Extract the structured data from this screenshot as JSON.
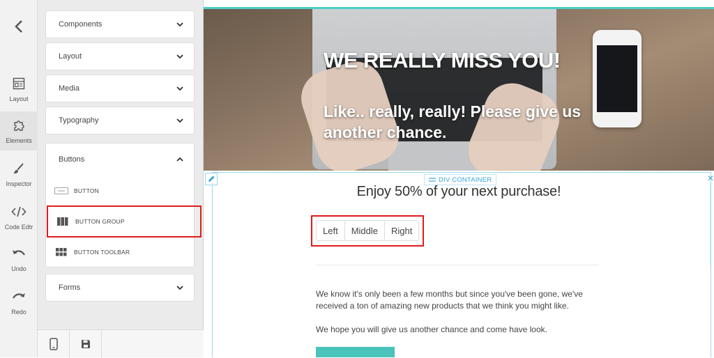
{
  "sidebar_rail": {
    "items": [
      {
        "label": "Layout",
        "icon": "layout-icon"
      },
      {
        "label": "Elements",
        "icon": "puzzle-icon"
      },
      {
        "label": "Inspector",
        "icon": "brush-icon"
      },
      {
        "label": "Code Edtr",
        "icon": "code-icon"
      },
      {
        "label": "Undo",
        "icon": "undo-icon"
      },
      {
        "label": "Redo",
        "icon": "redo-icon"
      }
    ],
    "active": "Elements"
  },
  "panel": {
    "sections": [
      {
        "label": "Components",
        "expanded": false
      },
      {
        "label": "Layout",
        "expanded": false
      },
      {
        "label": "Media",
        "expanded": false
      },
      {
        "label": "Typography",
        "expanded": false
      },
      {
        "label": "Buttons",
        "expanded": true
      },
      {
        "label": "Forms",
        "expanded": false
      }
    ],
    "buttons_items": [
      {
        "label": "BUTTON",
        "icon": "button-thumb-icon"
      },
      {
        "label": "BUTTON GROUP",
        "icon": "button-group-icon"
      },
      {
        "label": "BUTTON TOOLBAR",
        "icon": "button-toolbar-icon"
      }
    ],
    "highlighted_item": "BUTTON GROUP"
  },
  "canvas": {
    "hero_title": "WE REALLY MISS YOU!",
    "hero_subtitle": "Like.. really, really! Please give us another chance.",
    "container_tag": "DIV CONTAINER",
    "offer_heading": "Enjoy 50% of your next purchase!",
    "button_group": [
      "Left",
      "Middle",
      "Right"
    ],
    "paragraph_1": "We know it's only been a few months but since you've been gone, we've received a ton of amazing new products that we think you might like.",
    "paragraph_2": "We hope you will give us another chance and come have look."
  },
  "colors": {
    "accent": "#4ad0c8",
    "selection": "#9ad7f0",
    "highlight": "#e01b1b",
    "cta": "#4ac3bb"
  }
}
